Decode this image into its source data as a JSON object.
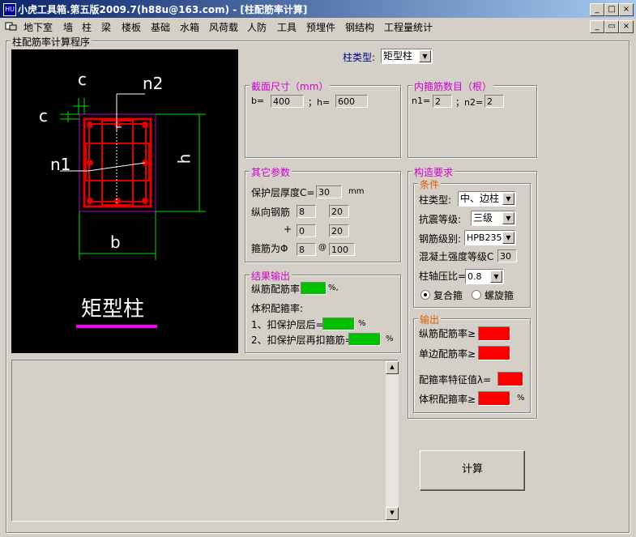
{
  "window": {
    "title": "小虎工具箱.第五版2009.7(h88u@163.com) - [柱配筋率计算]",
    "app_icon": "HU",
    "controls": [
      "_",
      "□",
      "×"
    ],
    "mdi_controls": [
      "_",
      "▭",
      "×"
    ]
  },
  "menu": {
    "items": [
      "地下室",
      "墙",
      "柱",
      "梁",
      "楼板",
      "基础",
      "水箱",
      "风荷载",
      "人防",
      "工具",
      "预埋件",
      "钢结构",
      "工程量统计"
    ]
  },
  "main": {
    "frame_title": "柱配筋率计算程序",
    "column_type_label": "柱类型:",
    "column_type_value": "矩型柱",
    "diagram": {
      "label_c_top": "c",
      "label_c_left": "c",
      "label_n2": "n2",
      "label_n1": "n1",
      "label_h": "h",
      "label_b": "b",
      "caption": "矩型柱"
    },
    "section": {
      "title": "截面尺寸（mm）",
      "b_label": "b=",
      "b_value": "400",
      "h_label": "；h=",
      "h_value": "600"
    },
    "stirrup_count": {
      "title": "内箍筋数目（根）",
      "n1_label": "n1=",
      "n1_value": "2",
      "n2_label": "；n2=",
      "n2_value": "2"
    },
    "other": {
      "title": "其它参数",
      "cover_label": "保护层厚度C=",
      "cover_value": "30",
      "cover_unit": "mm",
      "long_label": "纵向钢筋",
      "long_n1": "8",
      "long_d1": "20",
      "plus": "+",
      "long_n2": "0",
      "long_d2": "20",
      "stirrup_label": "箍筋为Φ",
      "stirrup_d": "8",
      "at": "@",
      "stirrup_s": "100"
    },
    "result": {
      "title": "结果输出",
      "long_ratio_label": "纵筋配筋率",
      "long_ratio_unit": "%,",
      "vol_label": "体积配箍率:",
      "vol1_label": "1、扣保护层后=",
      "vol1_unit": "%",
      "vol2_label": "2、扣保护层再扣箍筋=",
      "vol2_unit": "%"
    },
    "construct": {
      "title": "构造要求",
      "cond_title": "条件",
      "type_label": "柱类型:",
      "type_value": "中、边柱",
      "seismic_label": "抗震等级:",
      "seismic_value": "三级",
      "steel_label": "钢筋级别:",
      "steel_value": "HPB235",
      "concrete_label": "混凝土强度等级C",
      "concrete_value": "30",
      "axial_label": "柱轴压比=",
      "axial_value": "0.8",
      "radio1": "复合箍",
      "radio2": "螺旋箍"
    },
    "output": {
      "title": "输出",
      "long_min": "纵筋配筋率≥",
      "side_min": "单边配筋率≥",
      "lambda": "配箍率特征值λ=",
      "vol_min": "体积配箍率≥",
      "vol_unit": "%"
    },
    "calc_button": "计算"
  },
  "colors": {
    "title_bar_start": "#0a246a",
    "title_bar_end": "#a6caf0",
    "ok_fill": "#00c000",
    "warn_fill": "#ff0000",
    "accent_magenta": "#d000d0",
    "rebar_red": "#e00000"
  }
}
